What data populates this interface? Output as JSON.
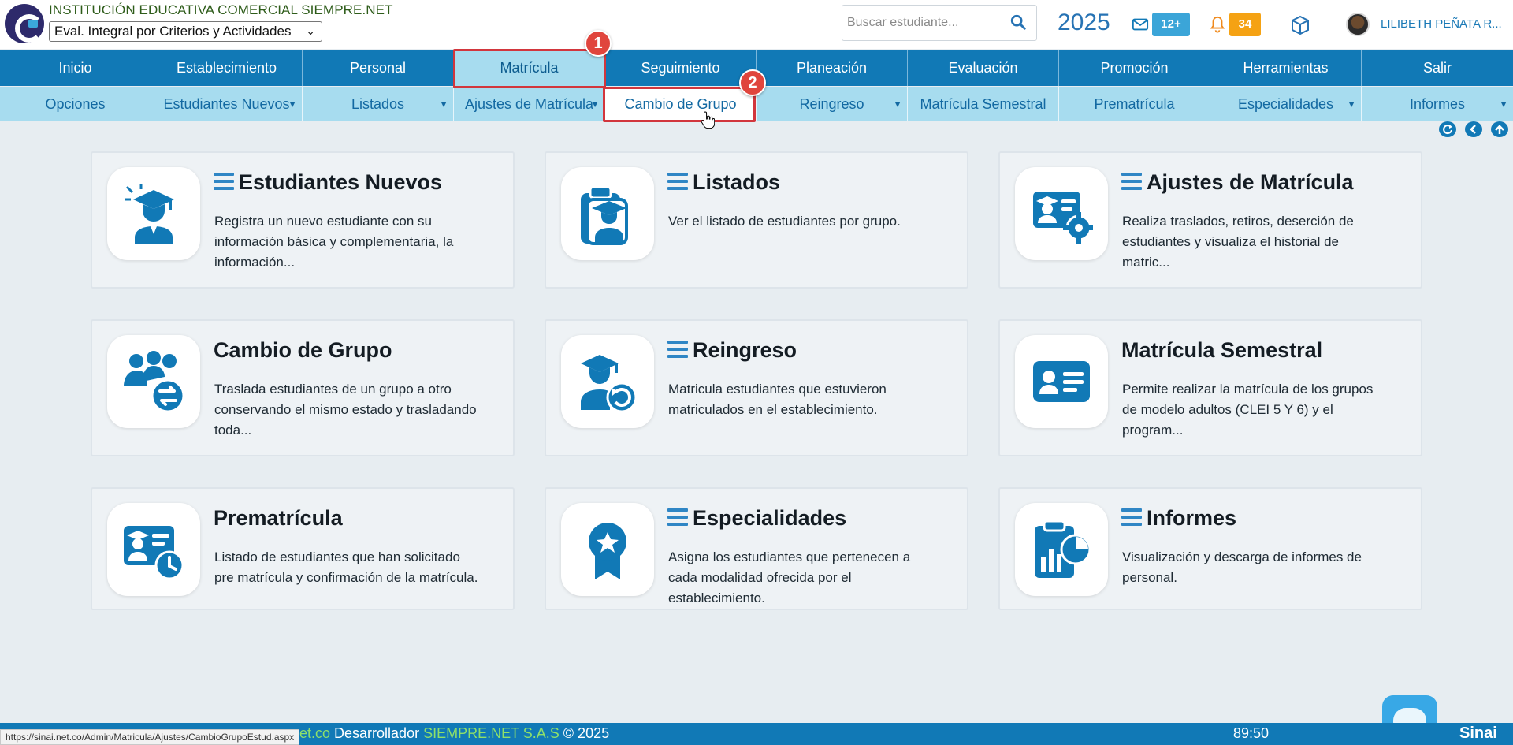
{
  "header": {
    "institution": "INSTITUCIÓN EDUCATIVA COMERCIAL SIEMPRE.NET",
    "eval_selected": "Eval. Integral por Criterios y Actividades",
    "search_placeholder": "Buscar estudiante...",
    "year": "2025",
    "mail_count": "12+",
    "notif_count": "34",
    "user_name": "LILIBETH PEÑATA R..."
  },
  "main_menu": [
    {
      "label": "Inicio",
      "icon": "home"
    },
    {
      "label": "Establecimiento"
    },
    {
      "label": "Personal"
    },
    {
      "label": "Matrícula",
      "active": true
    },
    {
      "label": "Seguimiento"
    },
    {
      "label": "Planeación"
    },
    {
      "label": "Evaluación"
    },
    {
      "label": "Promoción"
    },
    {
      "label": "Herramientas"
    },
    {
      "label": "Salir"
    }
  ],
  "sub_menu": [
    {
      "label": "Opciones",
      "dropdown": false
    },
    {
      "label": "Estudiantes Nuevos",
      "dropdown": true
    },
    {
      "label": "Listados",
      "dropdown": true
    },
    {
      "label": "Ajustes de Matrícula",
      "dropdown": true
    },
    {
      "label": "Cambio de Grupo",
      "dropdown": false,
      "hovered": true
    },
    {
      "label": "Reingreso",
      "dropdown": true
    },
    {
      "label": "Matrícula Semestral",
      "dropdown": false
    },
    {
      "label": "Prematrícula",
      "dropdown": false
    },
    {
      "label": "Especialidades",
      "dropdown": true
    },
    {
      "label": "Informes",
      "dropdown": true
    }
  ],
  "annotations": {
    "marker1": "1",
    "marker2": "2"
  },
  "cards": [
    {
      "title": "Estudiantes Nuevos",
      "menu": true,
      "icon": "new-student-icon",
      "desc": "Registra un nuevo estudiante con su información básica y complementaria, la información..."
    },
    {
      "title": "Listados",
      "menu": true,
      "icon": "list-students-icon",
      "desc": "Ver el listado de estudiantes por grupo."
    },
    {
      "title": "Ajustes de Matrícula",
      "menu": true,
      "icon": "enrollment-settings-icon",
      "desc": "Realiza traslados, retiros, deserción de estudiantes y visualiza el historial de matric..."
    },
    {
      "title": "Cambio de Grupo",
      "menu": false,
      "icon": "group-change-icon",
      "desc": "Traslada estudiantes de un grupo a otro conservando el mismo estado y trasladando toda..."
    },
    {
      "title": "Reingreso",
      "menu": true,
      "icon": "reentry-icon",
      "desc": "Matricula estudiantes que estuvieron matriculados en el establecimiento."
    },
    {
      "title": "Matrícula Semestral",
      "menu": false,
      "icon": "id-card-icon",
      "desc": "Permite realizar la matrícula de los grupos de modelo adultos (CLEI 5 Y 6) y el program..."
    },
    {
      "title": "Prematrícula",
      "menu": false,
      "icon": "pre-enrollment-icon",
      "desc": "Listado de estudiantes que han solicitado pre matrícula y confirmación de la matrícula."
    },
    {
      "title": "Especialidades",
      "menu": true,
      "icon": "award-icon",
      "desc": "Asigna los estudiantes que pertenecen a cada modalidad ofrecida por el establecimiento."
    },
    {
      "title": "Informes",
      "menu": true,
      "icon": "reports-icon",
      "desc": "Visualización y descarga de informes de personal."
    }
  ],
  "footer": {
    "status_url": "https://sinai.net.co/Admin/Matricula/Ajustes/CambioGrupoEstud.aspx",
    "domain_part": "et.co",
    "developer_label": " Desarrollador ",
    "company": "SIEMPRE.NET S.A.S",
    "copyright": " © 2025",
    "timer": "89:50",
    "brand": "Sinai"
  },
  "colors": {
    "primary": "#1179b6",
    "submenu": "#a7dcef",
    "highlight": "#d2363d",
    "mail_badge": "#3ba5d8",
    "bell_badge": "#f5a213"
  }
}
